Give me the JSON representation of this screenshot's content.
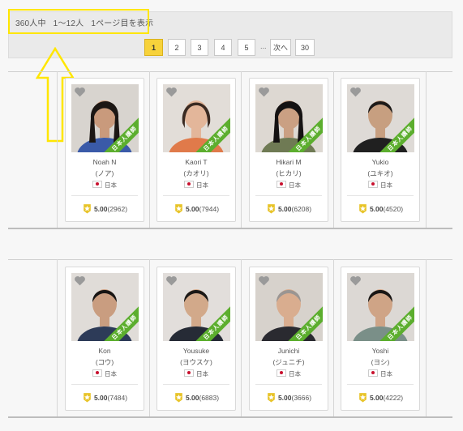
{
  "results": {
    "total": "360人中",
    "range": "1〜12人",
    "page_info": "1ページ目を表示"
  },
  "pagination": {
    "pages": [
      "1",
      "2",
      "3",
      "4",
      "5"
    ],
    "current": "1",
    "ellipsis": "...",
    "next": "次へ",
    "last": "30"
  },
  "ribbon_label": "日本人講師",
  "colors": {
    "active_page": "#f7d23b",
    "ribbon": "#5cae2e",
    "highlight": "#ffe600",
    "star": "#e8c42a"
  },
  "teachers": [
    {
      "name": "Noah N",
      "kana": "(ノア)",
      "nationality": "日本",
      "rating": "5.00",
      "reviews": "(2962)"
    },
    {
      "name": "Kaori T",
      "kana": "(カオリ)",
      "nationality": "日本",
      "rating": "5.00",
      "reviews": "(7944)"
    },
    {
      "name": "Hikari M",
      "kana": "(ヒカリ)",
      "nationality": "日本",
      "rating": "5.00",
      "reviews": "(6208)"
    },
    {
      "name": "Yukio",
      "kana": "(ユキオ)",
      "nationality": "日本",
      "rating": "5.00",
      "reviews": "(4520)"
    },
    {
      "name": "Kon",
      "kana": "(コウ)",
      "nationality": "日本",
      "rating": "5.00",
      "reviews": "(7484)"
    },
    {
      "name": "Yousuke",
      "kana": "(ヨウスケ)",
      "nationality": "日本",
      "rating": "5.00",
      "reviews": "(6883)"
    },
    {
      "name": "Junichi",
      "kana": "(ジュニチ)",
      "nationality": "日本",
      "rating": "5.00",
      "reviews": "(3666)"
    },
    {
      "name": "Yoshi",
      "kana": "(ヨシ)",
      "nationality": "日本",
      "rating": "5.00",
      "reviews": "(4222)"
    }
  ]
}
